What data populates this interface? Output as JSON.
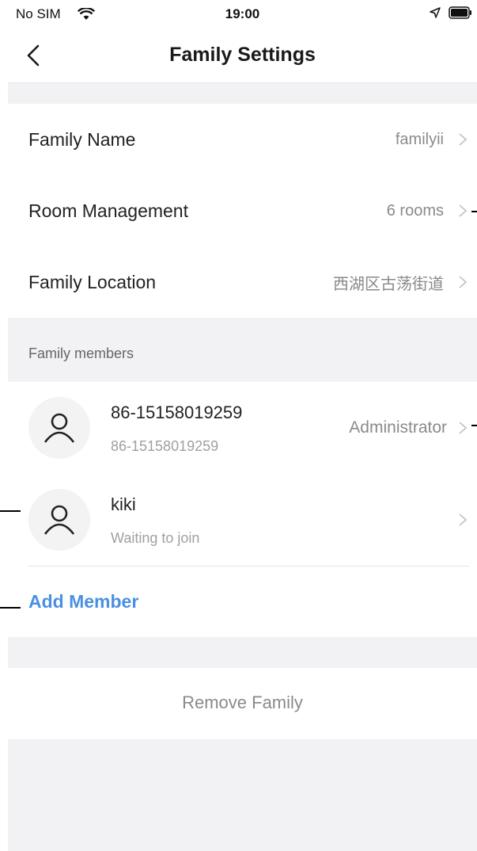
{
  "status_bar": {
    "carrier": "No SIM",
    "time": "19:00"
  },
  "nav": {
    "title": "Family Settings"
  },
  "settings": [
    {
      "label": "Family Name",
      "value": "familyii"
    },
    {
      "label": "Room Management",
      "value": "6 rooms"
    },
    {
      "label": "Family Location",
      "value": "西湖区古荡街道"
    }
  ],
  "members_section": {
    "label": "Family members"
  },
  "members": [
    {
      "name": "86-15158019259",
      "sub": "86-15158019259",
      "role": "Administrator"
    },
    {
      "name": "kiki",
      "sub": "Waiting to join",
      "role": ""
    }
  ],
  "actions": {
    "add_member": "Add Member",
    "remove_family": "Remove Family"
  },
  "colors": {
    "accent": "#4a90e2",
    "background": "#f2f2f4"
  }
}
